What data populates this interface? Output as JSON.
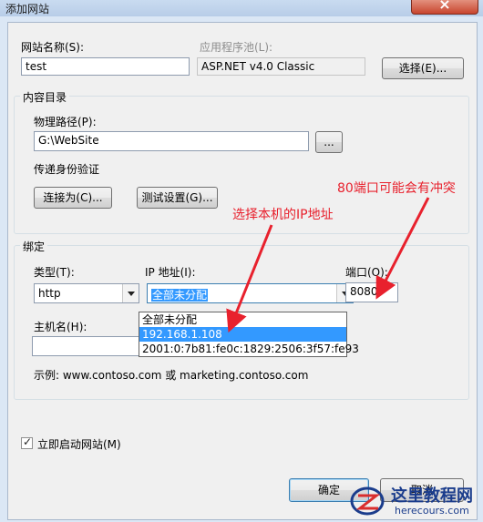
{
  "window": {
    "title": "添加网站"
  },
  "site": {
    "name_label": "网站名称(S):",
    "name_value": "test",
    "pool_label": "应用程序池(L):",
    "pool_value": "ASP.NET v4.0 Classic",
    "select_button": "选择(E)..."
  },
  "content": {
    "group_title": "内容目录",
    "path_label": "物理路径(P):",
    "path_value": "G:\\WebSite",
    "browse_button": "...",
    "auth_label": "传递身份验证",
    "connect_button": "连接为(C)...",
    "test_button": "测试设置(G)..."
  },
  "binding": {
    "group_title": "绑定",
    "type_label": "类型(T):",
    "type_value": "http",
    "ip_label": "IP 地址(I):",
    "ip_value": "全部未分配",
    "ip_options": [
      "全部未分配",
      "192.168.1.108",
      "2001:0:7b81:fe0c:1829:2506:3f57:fe93"
    ],
    "ip_selected_index": 1,
    "port_label": "端口(O):",
    "port_value": "8080",
    "host_label": "主机名(H):",
    "host_value": "",
    "example_text": "示例: www.contoso.com 或 marketing.contoso.com"
  },
  "start": {
    "checked": true,
    "label": "立即启动网站(M)"
  },
  "footer": {
    "ok_button": "确定",
    "cancel_button": "取消"
  },
  "annotations": {
    "ip_note": "选择本机的IP地址",
    "port_note": "80端口可能会有冲突",
    "color": "#e8212d"
  },
  "watermark": {
    "brand": "这里教程网",
    "url": "herecours.com"
  }
}
